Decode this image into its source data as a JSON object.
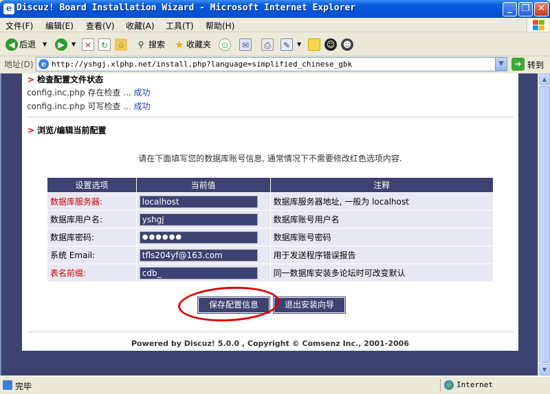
{
  "window": {
    "title": "Discuz! Board Installation Wizard - Microsoft Internet Explorer",
    "icon_glyph": "e",
    "minimize": "_",
    "maximize": "❐",
    "close": "✕"
  },
  "menu": [
    "文件(F)",
    "编辑(E)",
    "查看(V)",
    "收藏(A)",
    "工具(T)",
    "帮助(H)"
  ],
  "toolbar": {
    "back": "后退",
    "search": "搜索",
    "favorites": "收藏夹"
  },
  "address": {
    "label": "地址(D)",
    "url": "http://yshgj.xlphp.net/install.php?language=simplified_chinese_gbk",
    "go": "转到"
  },
  "content": {
    "section1_title": "检查配置文件状态",
    "checks": [
      {
        "prefix": "config.inc.php 存在检查 ... ",
        "result": "成功"
      },
      {
        "prefix": "config.inc.php 可写检查 ... ",
        "result": "成功"
      }
    ],
    "section2_title": "浏览/编辑当前配置",
    "notice": "请在下面填写您的数据库账号信息, 通常情况下不需要修改红色选项内容.",
    "table": {
      "headers": [
        "设置选项",
        "当前值",
        "注释"
      ],
      "rows": [
        {
          "label": "数据库服务器:",
          "value": "localhost",
          "note": "数据库服务器地址, 一般为 localhost",
          "red": true
        },
        {
          "label": "数据库用户名:",
          "value": "yshgj",
          "note": "数据库账号用户名",
          "red": false
        },
        {
          "label": "数据库密码:",
          "value": "●●●●●●",
          "note": "数据库账号密码",
          "red": false
        },
        {
          "label": "系统 Email:",
          "value": "tfls204yf@163.com",
          "note": "用于发送程序错误报告",
          "red": false
        },
        {
          "label": "表名前缀:",
          "value": "cdb_",
          "note": "同一数据库安装多论坛时可改变默认",
          "red": true
        }
      ]
    },
    "save_button": "保存配置信息",
    "exit_button": "退出安装向导",
    "footer": "Powered by Discuz! 5.0.0 ,  Copyright © Comsenz Inc., 2001-2006"
  },
  "status": {
    "text": "完毕",
    "zone": "Internet"
  },
  "colors": {
    "accent": "#3c4271",
    "highlight": "#e00000"
  }
}
